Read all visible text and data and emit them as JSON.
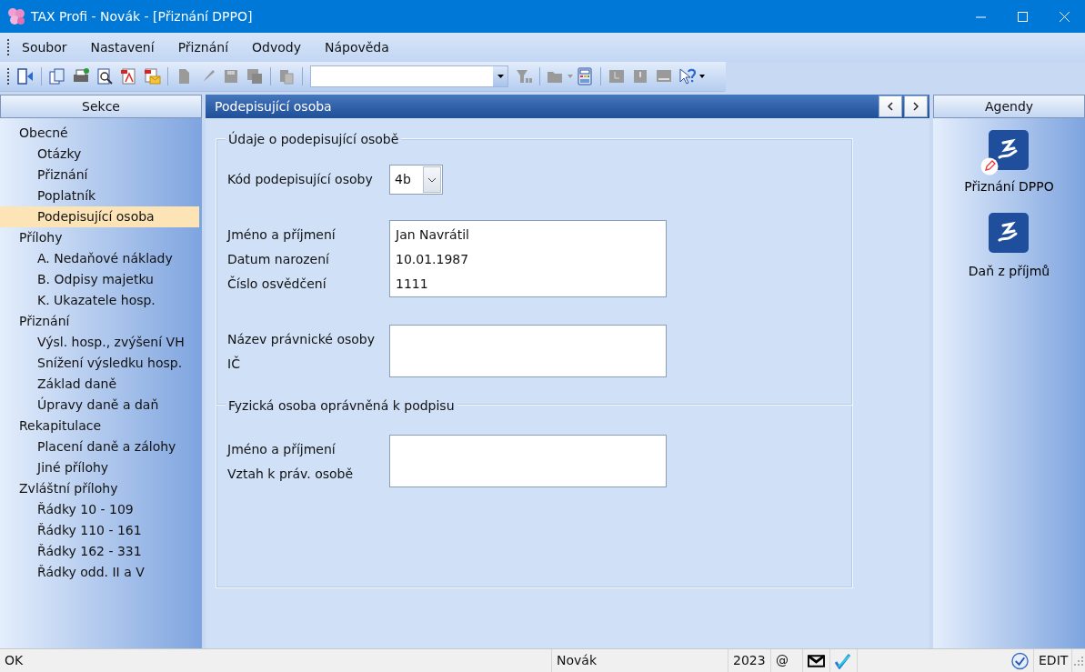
{
  "window": {
    "title": "TAX Profi - Novák - [Přiznání DPPO]"
  },
  "menu": [
    {
      "label": "Soubor"
    },
    {
      "label": "Nastavení"
    },
    {
      "label": "Přiznání"
    },
    {
      "label": "Odvody"
    },
    {
      "label": "Nápověda"
    }
  ],
  "sidebar": {
    "header": "Sekce",
    "items": [
      {
        "label": "Obecné",
        "selected": false,
        "children": [
          {
            "label": "Otázky",
            "selected": false
          },
          {
            "label": "Přiznání",
            "selected": false
          },
          {
            "label": "Poplatník",
            "selected": false
          },
          {
            "label": "Podepisující osoba",
            "selected": true
          }
        ]
      },
      {
        "label": "Přílohy",
        "selected": false,
        "children": [
          {
            "label": "A. Nedaňové náklady",
            "selected": false
          },
          {
            "label": "B. Odpisy majetku",
            "selected": false
          },
          {
            "label": "K. Ukazatele hosp.",
            "selected": false
          }
        ]
      },
      {
        "label": "Přiznání",
        "selected": false,
        "children": [
          {
            "label": "Výsl. hosp., zvýšení VH",
            "selected": false
          },
          {
            "label": "Snížení výsledku hosp.",
            "selected": false
          },
          {
            "label": "Základ daně",
            "selected": false
          },
          {
            "label": "Úpravy daně a daň",
            "selected": false
          }
        ]
      },
      {
        "label": "Rekapitulace",
        "selected": false,
        "children": [
          {
            "label": "Placení daně a zálohy",
            "selected": false
          },
          {
            "label": "Jiné přílohy",
            "selected": false
          }
        ]
      },
      {
        "label": "Zvláštní přílohy",
        "selected": false,
        "children": [
          {
            "label": "Řádky 10 - 109",
            "selected": false
          },
          {
            "label": "Řádky 110 - 161",
            "selected": false
          },
          {
            "label": "Řádky 162 - 331",
            "selected": false
          },
          {
            "label": "Řádky odd. II a V",
            "selected": false
          }
        ]
      }
    ]
  },
  "panel": {
    "title": "Podepisující osoba",
    "section": {
      "legend": "Údaje o podepisující osobě",
      "code": {
        "label": "Kód podepisující osoby",
        "value": "4b"
      },
      "groups": [
        {
          "labels": [
            "Jméno a příjmení",
            "Datum narození",
            "Číslo osvědčení"
          ],
          "values": [
            "Jan Navrátil",
            "10.01.1987",
            "1111"
          ]
        },
        {
          "labels": [
            "Název právnické osoby",
            "IČ"
          ]
        }
      ]
    },
    "subsection": {
      "legend": "Fyzická osoba oprávněná k podpisu",
      "groups": [
        {
          "labels": [
            "Jméno a příjmení",
            "Vztah k práv. osobě"
          ]
        }
      ]
    }
  },
  "agendas": {
    "header": "Agendy",
    "items": [
      {
        "label": "Přiznání DPPO",
        "edited": true
      },
      {
        "label": "Daň z příjmů",
        "edited": false
      }
    ]
  },
  "status_bar": {
    "message": "OK",
    "user": "Novák",
    "year": "2023",
    "at": "@",
    "mode": "EDIT"
  }
}
